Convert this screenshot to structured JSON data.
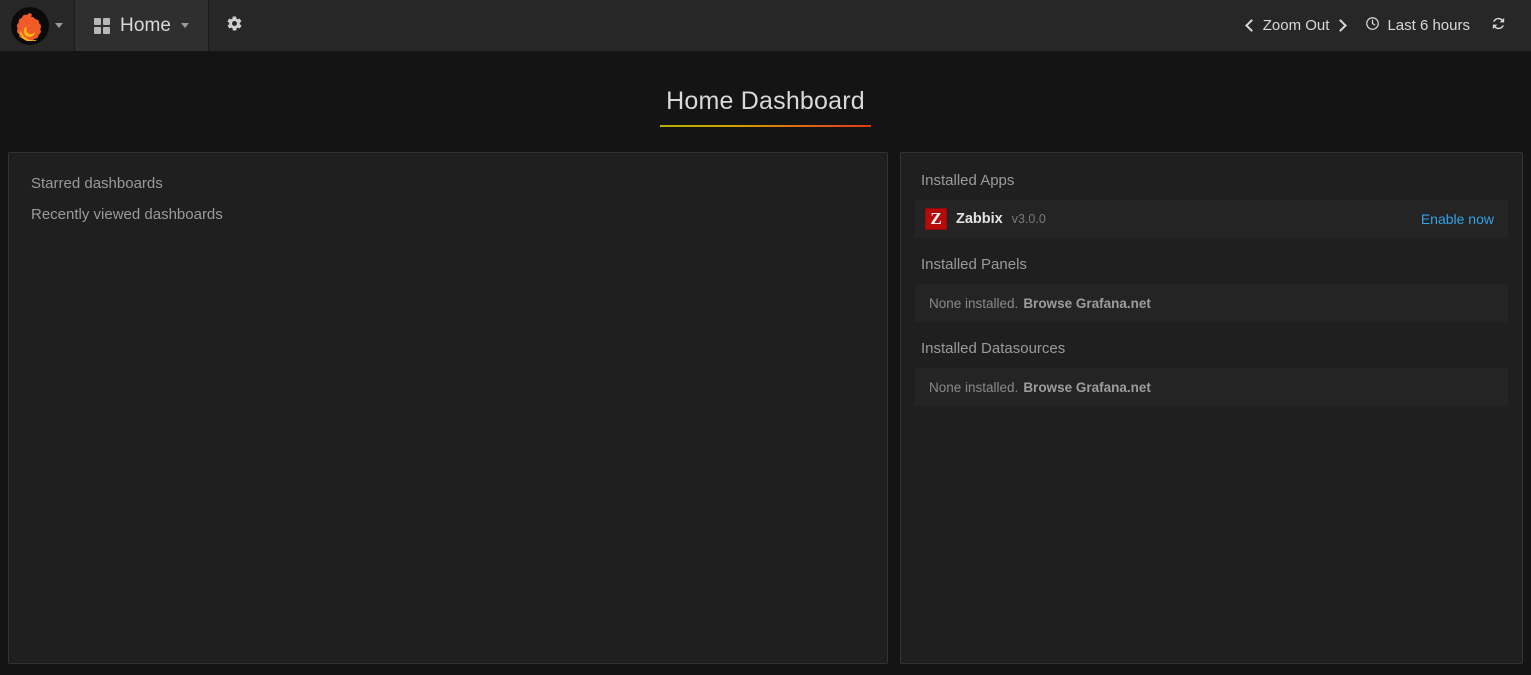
{
  "navbar": {
    "logo_icon": "grafana-logo-icon",
    "logo_caret_icon": "chevron-down-icon",
    "home": {
      "icon": "dashboard-grid-icon",
      "label": "Home",
      "caret_icon": "chevron-down-icon"
    },
    "settings_icon": "gear-icon",
    "zoom_out": {
      "prev_icon": "chevron-left-icon",
      "label": "Zoom Out",
      "next_icon": "chevron-right-icon"
    },
    "time_range": {
      "icon": "clock-icon",
      "label": "Last 6 hours"
    },
    "refresh_icon": "refresh-icon"
  },
  "dashboard": {
    "title": "Home Dashboard"
  },
  "left_panel": {
    "headings": [
      "Starred dashboards",
      "Recently viewed dashboards"
    ]
  },
  "right_panel": {
    "sections": [
      {
        "title": "Installed Apps",
        "type": "apps",
        "items": [
          {
            "logo_letter": "Z",
            "name": "Zabbix",
            "version": "v3.0.0",
            "action": "Enable now"
          }
        ]
      },
      {
        "title": "Installed Panels",
        "type": "empty",
        "empty_text": "None installed.",
        "empty_link": "Browse Grafana.net"
      },
      {
        "title": "Installed Datasources",
        "type": "empty",
        "empty_text": "None installed.",
        "empty_link": "Browse Grafana.net"
      }
    ]
  },
  "colors": {
    "navbar_bg": "#272727",
    "body_bg": "#141414",
    "panel_bg": "#1f1f1f",
    "row_bg": "#242424",
    "link_blue": "#33a2e5",
    "zabbix_red": "#b50b0b",
    "title_underline_start": "#b5b000",
    "title_underline_end": "#dd3b12"
  }
}
